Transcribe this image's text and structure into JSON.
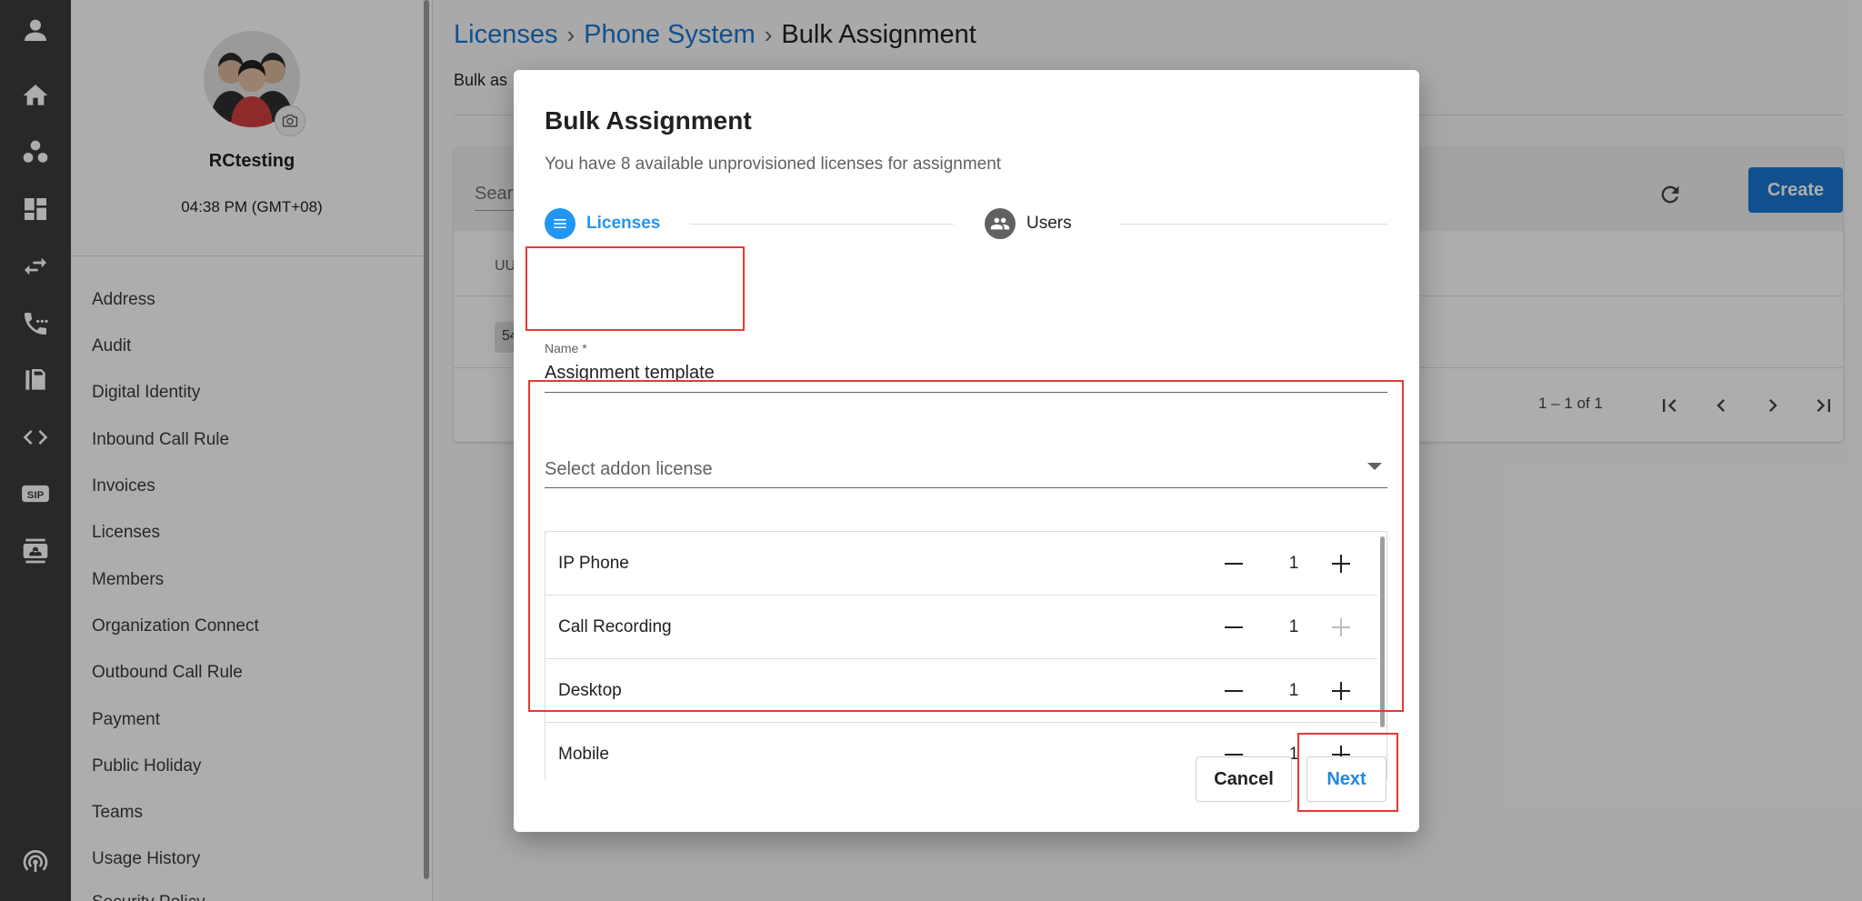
{
  "sidebar": {
    "org_name": "RCtesting",
    "time": "04:38 PM (GMT+08)",
    "items": [
      {
        "label": "Address"
      },
      {
        "label": "Audit"
      },
      {
        "label": "Digital Identity"
      },
      {
        "label": "Inbound Call Rule"
      },
      {
        "label": "Invoices"
      },
      {
        "label": "Licenses"
      },
      {
        "label": "Members"
      },
      {
        "label": "Organization Connect"
      },
      {
        "label": "Outbound Call Rule"
      },
      {
        "label": "Payment"
      },
      {
        "label": "Public Holiday"
      },
      {
        "label": "Teams"
      },
      {
        "label": "Usage History"
      },
      {
        "label": "Security Policy"
      }
    ]
  },
  "rail": {
    "icons": [
      "user-icon",
      "home-icon",
      "team-icon",
      "dashboard-icon",
      "transfer-icon",
      "phone-icon",
      "fax-icon",
      "code-icon",
      "sip-icon",
      "contacts-icon",
      "broadcast-icon"
    ],
    "sip_label": "SIP"
  },
  "breadcrumb": {
    "items": [
      "Licenses",
      "Phone System"
    ],
    "current": "Bulk Assignment"
  },
  "page": {
    "subtitle": "Bulk as",
    "search_placeholder": "Searc",
    "create_label": "Create",
    "table_header_uuid": "UU",
    "row_uuid": "54",
    "pagination": "1 – 1 of 1"
  },
  "dialog": {
    "title": "Bulk Assignment",
    "subtitle": "You have 8 available unprovisioned licenses for assignment",
    "steps": [
      {
        "label": "Licenses",
        "active": true
      },
      {
        "label": "Users",
        "active": false
      }
    ],
    "name_label": "Name *",
    "name_value": "Assignment template",
    "select_placeholder": "Select addon license",
    "licenses": [
      {
        "name": "IP Phone",
        "qty": "1",
        "plus_disabled": false
      },
      {
        "name": "Call Recording",
        "qty": "1",
        "plus_disabled": true
      },
      {
        "name": "Desktop",
        "qty": "1",
        "plus_disabled": false
      },
      {
        "name": "Mobile",
        "qty": "1",
        "plus_disabled": false
      }
    ],
    "cancel_label": "Cancel",
    "next_label": "Next"
  },
  "colors": {
    "accent": "#1976d2",
    "step_active": "#2196f3",
    "highlight": "#e53935"
  }
}
